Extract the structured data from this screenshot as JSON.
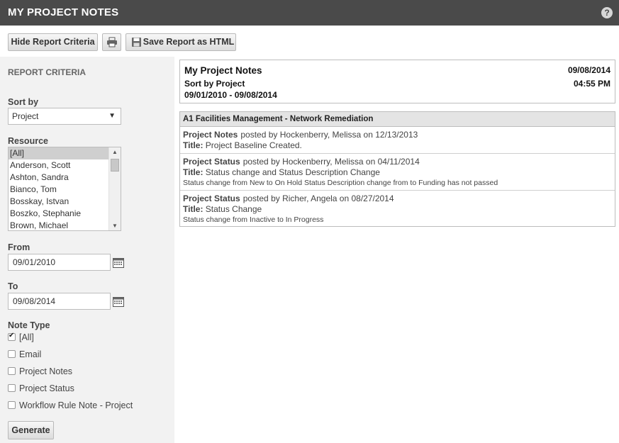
{
  "titlebar": {
    "title": "MY PROJECT NOTES",
    "help_glyph": "?"
  },
  "toolbar": {
    "hide_label": "Hide Report Criteria",
    "save_label": "Save Report as HTML"
  },
  "criteria": {
    "heading": "REPORT CRITERIA",
    "sort_label": "Sort by",
    "sort_value": "Project",
    "resource_label": "Resource",
    "resources": [
      "[All]",
      "Anderson, Scott",
      "Ashton, Sandra",
      "Bianco, Tom",
      "Bosskay, Istvan",
      "Boszko, Stephanie",
      "Brown, Michael"
    ],
    "from_label": "From",
    "from_value": "09/01/2010",
    "to_label": "To",
    "to_value": "09/08/2014",
    "note_type_label": "Note Type",
    "note_types": [
      {
        "label": "[All]",
        "checked": true
      },
      {
        "label": "Email",
        "checked": false
      },
      {
        "label": "Project Notes",
        "checked": false
      },
      {
        "label": "Project Status",
        "checked": false
      },
      {
        "label": "Workflow Rule Note - Project",
        "checked": false
      }
    ],
    "generate_label": "Generate"
  },
  "report": {
    "title": "My Project Notes",
    "sort_text": "Sort by Project",
    "range_text": "09/01/2010 - 09/08/2014",
    "date": "09/08/2014",
    "time": "04:55 PM"
  },
  "group": {
    "heading": "A1 Facilities Management - Network Remediation",
    "title_label": "Title:",
    "notes": [
      {
        "type": "Project Notes",
        "posted": "posted by Hockenberry, Melissa on 12/13/2013",
        "title": "Project Baseline Created.",
        "detail": ""
      },
      {
        "type": "Project Status",
        "posted": "posted by Hockenberry, Melissa on 04/11/2014",
        "title": "Status change and Status Description Change",
        "detail": "Status change from New to On Hold Status Description change from to Funding has not passed"
      },
      {
        "type": "Project Status",
        "posted": "posted by Richer, Angela on 08/27/2014",
        "title": "Status Change",
        "detail": "Status change from Inactive to In Progress"
      }
    ]
  }
}
